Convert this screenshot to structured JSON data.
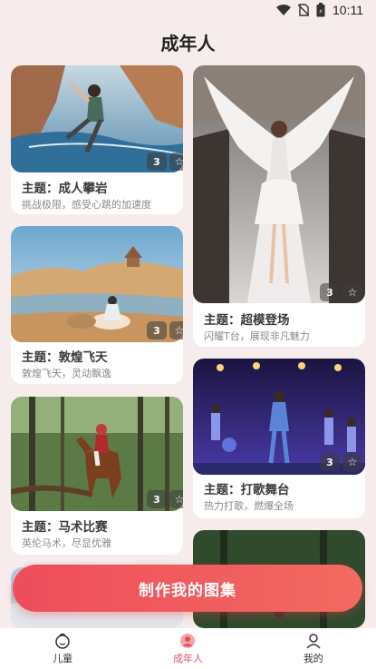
{
  "status_bar": {
    "time": "10:11"
  },
  "header": {
    "title": "成年人"
  },
  "cards": [
    {
      "id": "climbing",
      "title": "主题：成人攀岩",
      "subtitle": "挑战极限，感受心跳的加速度",
      "count": "3"
    },
    {
      "id": "dunhuang",
      "title": "主题：敦煌飞天",
      "subtitle": "敦煌飞天，灵动飘逸",
      "count": "3"
    },
    {
      "id": "equestrian",
      "title": "主题：马术比赛",
      "subtitle": "英伦马术，尽显优雅",
      "count": "3"
    },
    {
      "id": "runway",
      "title": "主题：超模登场",
      "subtitle": "闪耀T台，展现非凡魅力",
      "count": "3"
    },
    {
      "id": "concert",
      "title": "主题：打歌舞台",
      "subtitle": "热力打歌，燃爆全场",
      "count": "3"
    }
  ],
  "cta": {
    "label": "制作我的图集"
  },
  "bottom_nav": {
    "items": [
      {
        "label": "儿童",
        "icon": "kid-face-icon",
        "active": false
      },
      {
        "label": "成年人",
        "icon": "adult-avatar-icon",
        "active": true
      },
      {
        "label": "我的",
        "icon": "person-icon",
        "active": false
      }
    ]
  },
  "colors": {
    "accent": "#e94c58",
    "background": "#f7ecec"
  }
}
